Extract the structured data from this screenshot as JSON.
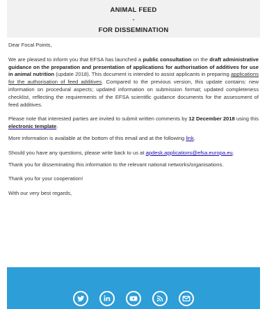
{
  "header": {
    "title": "ANIMAL FEED",
    "dash": "-",
    "subtitle": "FOR DISSEMINATION"
  },
  "email": {
    "greeting": "Dear Focal Points,",
    "p1": {
      "t1": "We are pleased to inform you that EFSA has launched a ",
      "b1": "public consultation",
      "t2": " on the ",
      "b2": "draft administrative guidance on the preparation and presentation of applications for authorisation of additives for use in animal nutrition",
      "t3": " (update 2018). This document is intended to assist applicants in preparing ",
      "link1": "applications for the authorisation of feed additives",
      "t4": ". Compared to the previous version, this update contains: new information on procedural aspects; updated information on submission format; updated completeness checklist, reflecting the requirements of the EFSA scientific guidance documents for the assessment of feed additives."
    },
    "p2": {
      "t1": "Please note that interested parties are invited to submit written comments by ",
      "b1": "12 December 2018",
      "t2": " using this ",
      "link1": "electronic template",
      "t3": "."
    },
    "p3": {
      "t1": "More information is available at the bottom of this email and at the following ",
      "link1": "link",
      "t2": "."
    },
    "p4": {
      "t1": "Should you have any questions, please write back to us at ",
      "link1": "apdesk.applications@efsa.europa.eu",
      "t2": "."
    },
    "p5": "Thank you for disseminating this information to the relevant national networks/organisations.",
    "p6": "Thank you for your cooperation!",
    "p7": "With our very best regards,"
  },
  "footer": {
    "icons": [
      "twitter-icon",
      "linkedin-icon",
      "youtube-icon",
      "rss-icon",
      "email-icon"
    ],
    "background": "#2d9ed8"
  }
}
